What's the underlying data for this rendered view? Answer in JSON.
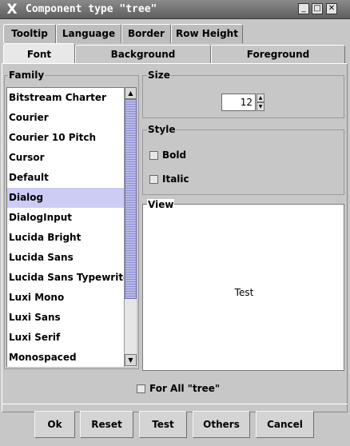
{
  "window": {
    "title": "Component type \"tree\""
  },
  "tabs": {
    "row1": [
      "Tooltip",
      "Language",
      "Border",
      "Row Height"
    ],
    "row2": [
      "Font",
      "Background",
      "Foreground"
    ]
  },
  "family": {
    "label": "Family",
    "items": [
      "Bitstream Charter",
      "Courier",
      "Courier 10 Pitch",
      "Cursor",
      "Default",
      "Dialog",
      "DialogInput",
      "Lucida Bright",
      "Lucida Sans",
      "Lucida Sans Typewriter",
      "Luxi Mono",
      "Luxi Sans",
      "Luxi Serif",
      "Monospaced"
    ],
    "selected": "Dialog"
  },
  "size": {
    "label": "Size",
    "value": "12"
  },
  "style": {
    "label": "Style",
    "bold": "Bold",
    "italic": "Italic"
  },
  "view": {
    "label": "View",
    "sample": "Test"
  },
  "for_all": {
    "label": "For All \"tree\""
  },
  "buttons": {
    "ok": "Ok",
    "reset": "Reset",
    "test": "Test",
    "others": "Others",
    "cancel": "Cancel"
  },
  "icons": {
    "window_menu": "x-logo-icon",
    "minimize": "minimize-icon",
    "maximize": "maximize-icon",
    "close": "close-icon"
  }
}
